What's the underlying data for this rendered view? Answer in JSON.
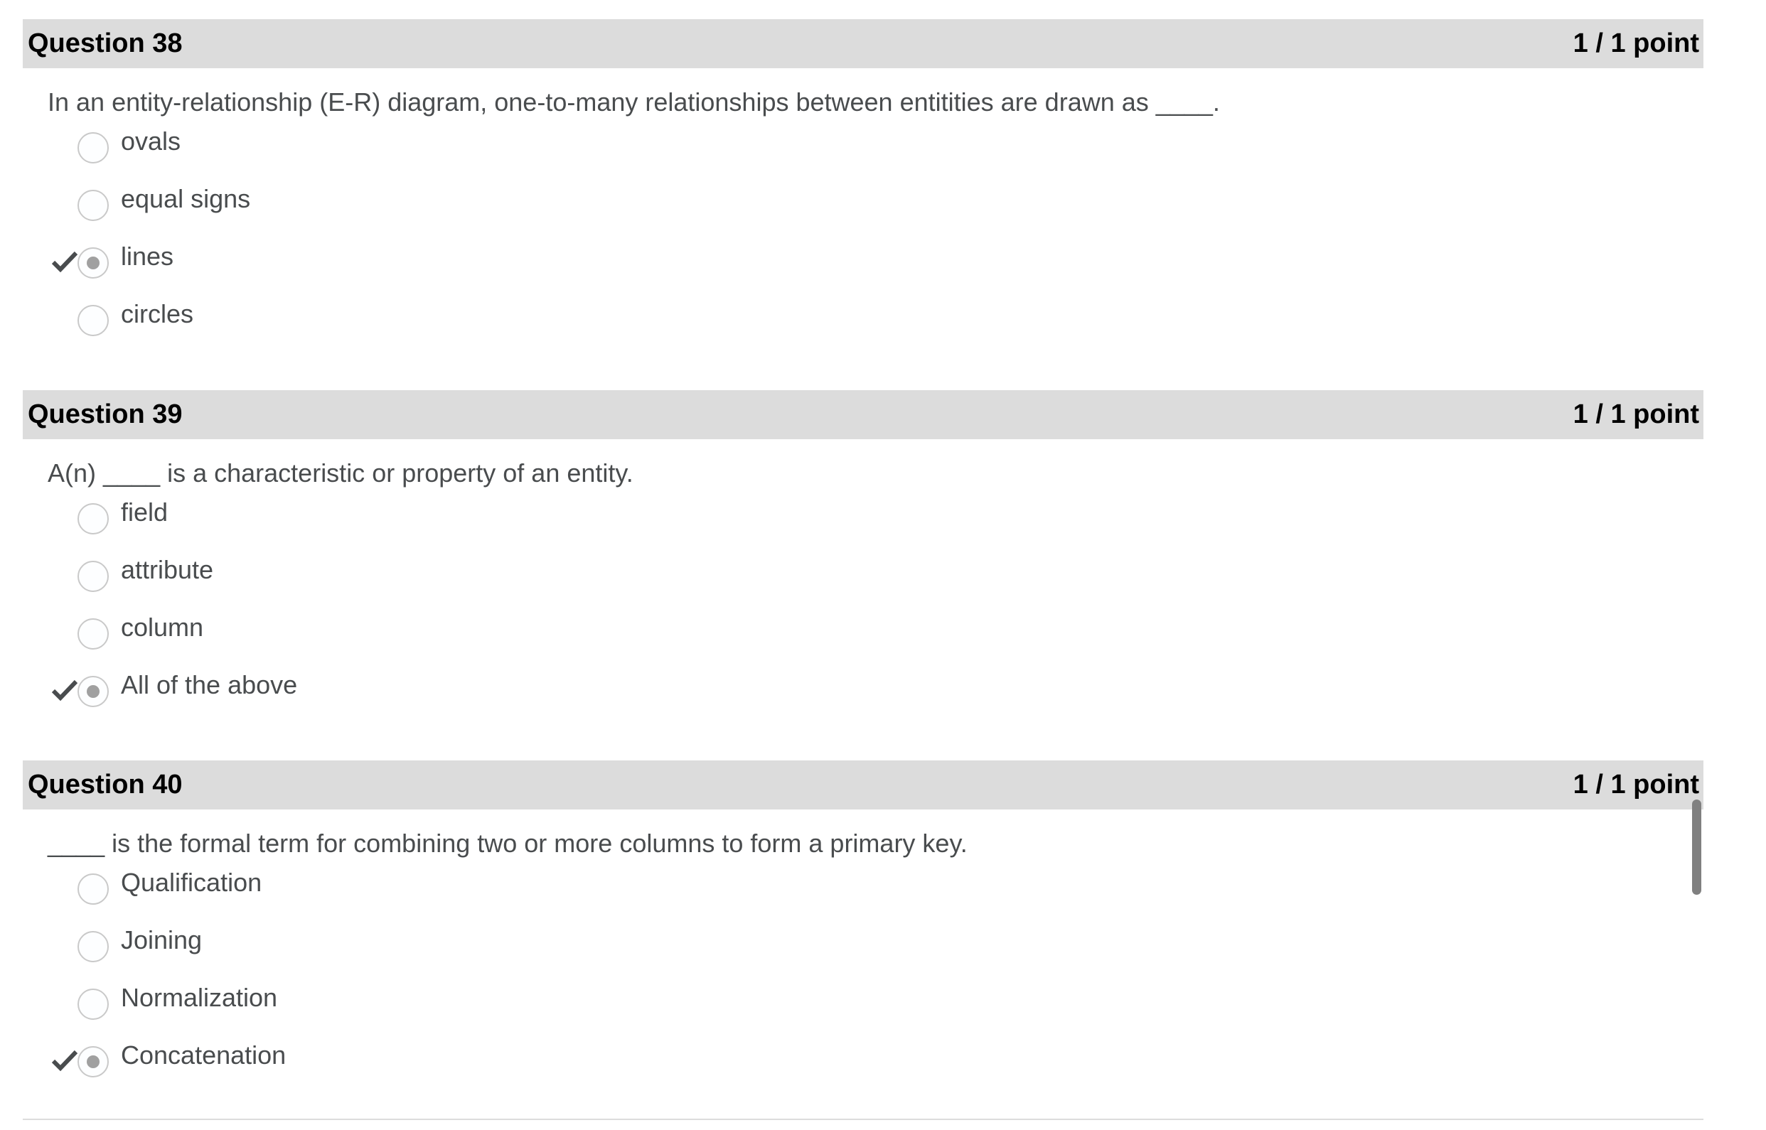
{
  "questions": [
    {
      "title": "Question 38",
      "points": "1 / 1 point",
      "text": "In an entity-relationship (E-R) diagram, one-to-many relationships between entitities are drawn as ____.",
      "options": [
        {
          "label": "ovals",
          "selected": false,
          "correct": false
        },
        {
          "label": "equal signs",
          "selected": false,
          "correct": false
        },
        {
          "label": "lines",
          "selected": true,
          "correct": true
        },
        {
          "label": "circles",
          "selected": false,
          "correct": false
        }
      ]
    },
    {
      "title": "Question 39",
      "points": "1 / 1 point",
      "text": "A(n) ____ is a characteristic or property of an entity.",
      "options": [
        {
          "label": "field",
          "selected": false,
          "correct": false
        },
        {
          "label": "attribute",
          "selected": false,
          "correct": false
        },
        {
          "label": "column",
          "selected": false,
          "correct": false
        },
        {
          "label": "All of the above",
          "selected": true,
          "correct": true
        }
      ]
    },
    {
      "title": "Question 40",
      "points": "1 / 1 point",
      "text": "____ is the formal term for combining two or more columns to form a primary key.",
      "options": [
        {
          "label": "Qualification",
          "selected": false,
          "correct": false
        },
        {
          "label": "Joining",
          "selected": false,
          "correct": false
        },
        {
          "label": "Normalization",
          "selected": false,
          "correct": false
        },
        {
          "label": "Concatenation",
          "selected": true,
          "correct": true
        }
      ]
    }
  ],
  "colors": {
    "header_bg": "#dcdcdc",
    "text": "#494c4e",
    "selected_dot": "#a0a0a0",
    "check": "#494c4e"
  },
  "icons": {
    "correct": "checkmark-icon"
  }
}
